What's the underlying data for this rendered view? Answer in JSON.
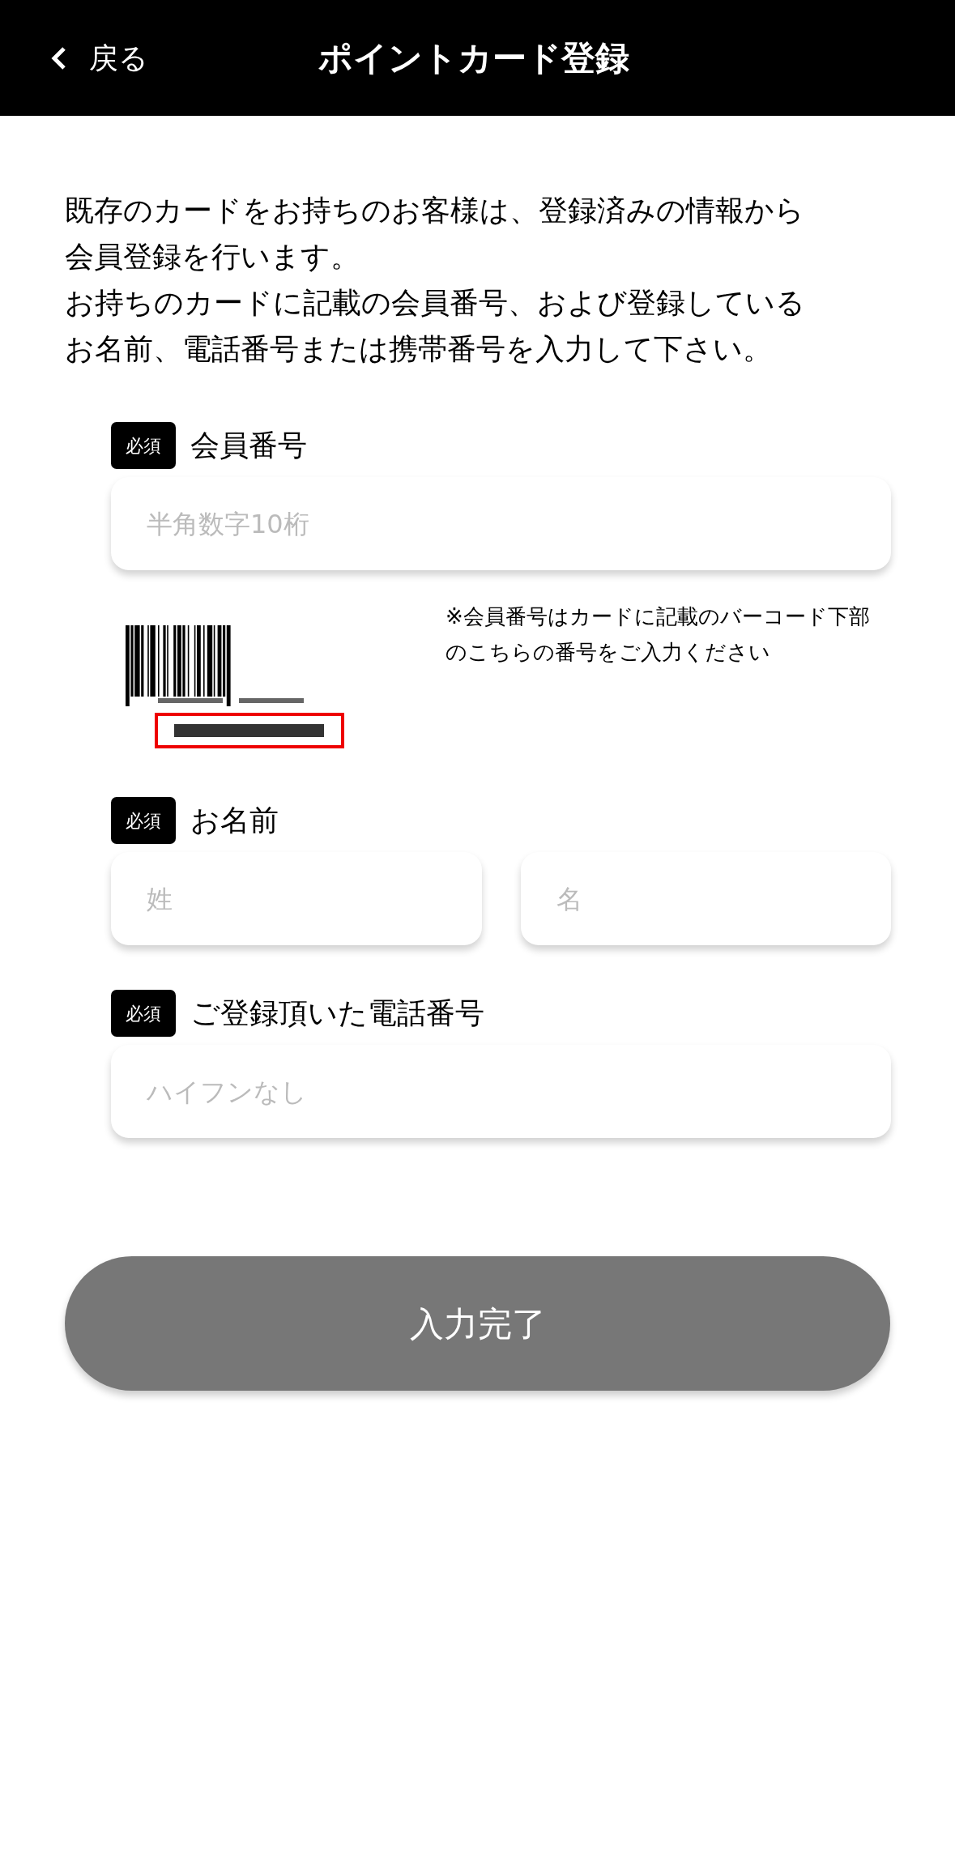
{
  "header": {
    "back": "戻る",
    "title": "ポイントカード登録"
  },
  "intro": [
    "既存のカードをお持ちのお客様は、登録済みの情報から",
    "会員登録を行います。",
    "お持ちのカードに記載の会員番号、および登録している",
    "お名前、電話番号または携帯番号を入力して下さい。"
  ],
  "fields": [
    {
      "badge": "必須",
      "label": "会員番号",
      "inputs": [
        {
          "placeholder": "半角数字10桁"
        }
      ],
      "note": "※会員番号はカードに記載のバーコード下部のこちらの番号をご入力ください"
    },
    {
      "badge": "必須",
      "label": "お名前",
      "inputs": [
        {
          "placeholder": "姓"
        },
        {
          "placeholder": "名"
        }
      ]
    },
    {
      "badge": "必須",
      "label": "ご登録頂いた電話番号",
      "inputs": [
        {
          "placeholder": "ハイフンなし"
        }
      ]
    }
  ],
  "submit": {
    "label": "入力完了",
    "disabled": true
  }
}
